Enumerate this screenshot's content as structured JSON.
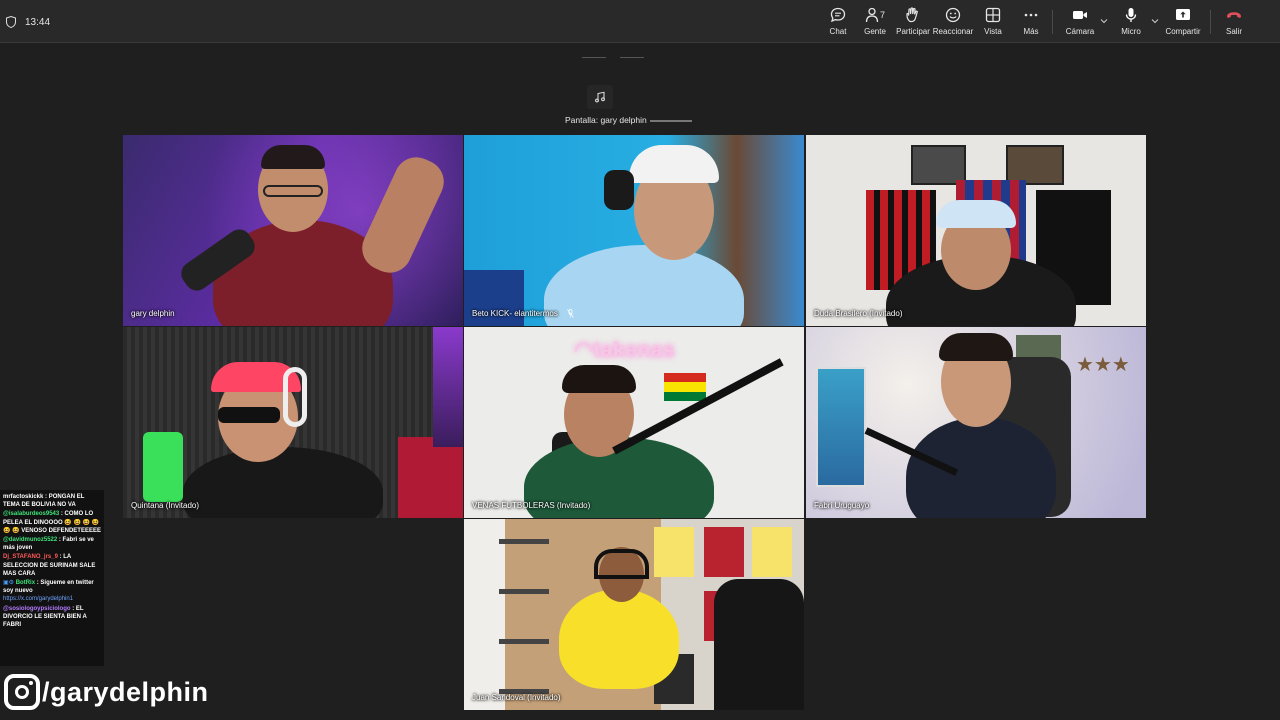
{
  "status": {
    "time": "13:44"
  },
  "toolbar": {
    "chat": "Chat",
    "people": "Gente",
    "people_count": "7",
    "participate": "Participar",
    "react": "Reaccionar",
    "view": "Vista",
    "more": "Más",
    "camera": "Cámara",
    "mic": "Micro",
    "share": "Compartir",
    "leave": "Salir",
    "leave_color": "#e0505a"
  },
  "screen_share": {
    "label": "Pantalla: gary delphin"
  },
  "participants": [
    {
      "name": "gary delphin"
    },
    {
      "name": "Beto KICK- elantitermos"
    },
    {
      "name": "Duda Brasilero (Invitado)"
    },
    {
      "name": "Quintana (Invitado)"
    },
    {
      "name": "VENAS FUTBOLERAS (Invitado)"
    },
    {
      "name": "Fabri Uruguayo"
    },
    {
      "name": "Juan Sandoval (Invitado)"
    }
  ],
  "chat_overlay": [
    {
      "user": "mrfactoskickk",
      "user_color": "#ffffff",
      "text": " : PONGAN EL TEMA DE BOLIVIA NO VA"
    },
    {
      "user": "@isalaburdeos9543",
      "user_color": "#3fe37a",
      "text": " : COMO LO PELEA EL DINOOOO 😆 😆 😆 😆 😆 😆 VENOSO DEFENDETEEEEE"
    },
    {
      "user": "@davidmunoz5522",
      "user_color": "#3fe37a",
      "text": " : Fabri se ve más joven"
    },
    {
      "user": "Dj_STAFANO_jrs_9",
      "user_color": "#ff5a5a",
      "text": " : LA SELECCION DE SURINAM SALE MAS CARA"
    },
    {
      "user": "BotRix",
      "user_color": "#3fe37a",
      "text": " : Sígueme en twitter soy nuevo",
      "link": "https://x.com/garydelphin1"
    },
    {
      "user": "@sosiologoypsiciologo",
      "user_color": "#b57cff",
      "text": " : EL DIVORCIO LE SIENTA BIEN A FABRI"
    }
  ],
  "social_handle": "/garydelphin"
}
